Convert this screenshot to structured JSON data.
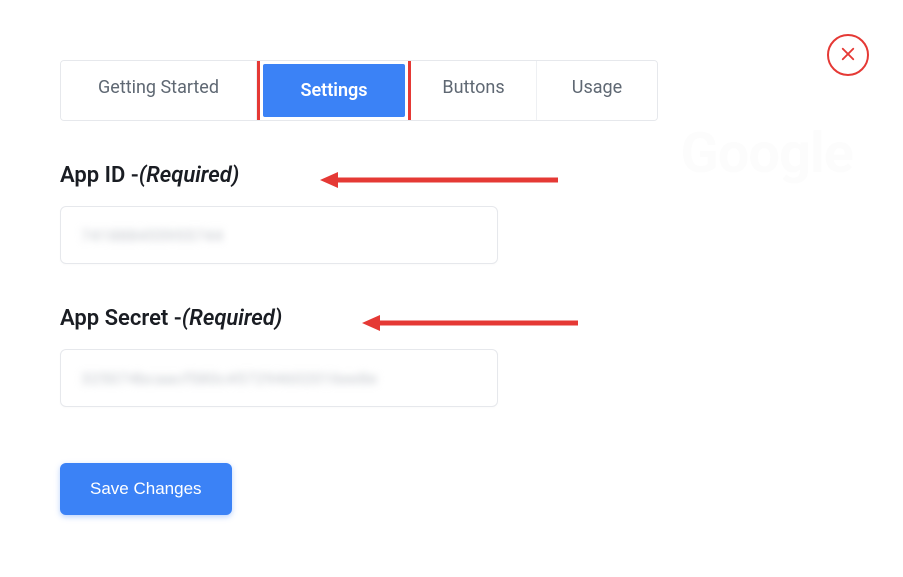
{
  "close": {
    "name": "close"
  },
  "brand": "Google",
  "tabs": [
    {
      "label": "Getting Started"
    },
    {
      "label": "Settings"
    },
    {
      "label": "Buttons"
    },
    {
      "label": "Usage"
    }
  ],
  "fields": {
    "app_id": {
      "label": "App ID - ",
      "required": "(Required)",
      "value": "741888455955744"
    },
    "app_secret": {
      "label": "App Secret - ",
      "required": "(Required)",
      "value": "325074bcaacf580c457294602016ee8e"
    }
  },
  "actions": {
    "save": "Save Changes"
  }
}
